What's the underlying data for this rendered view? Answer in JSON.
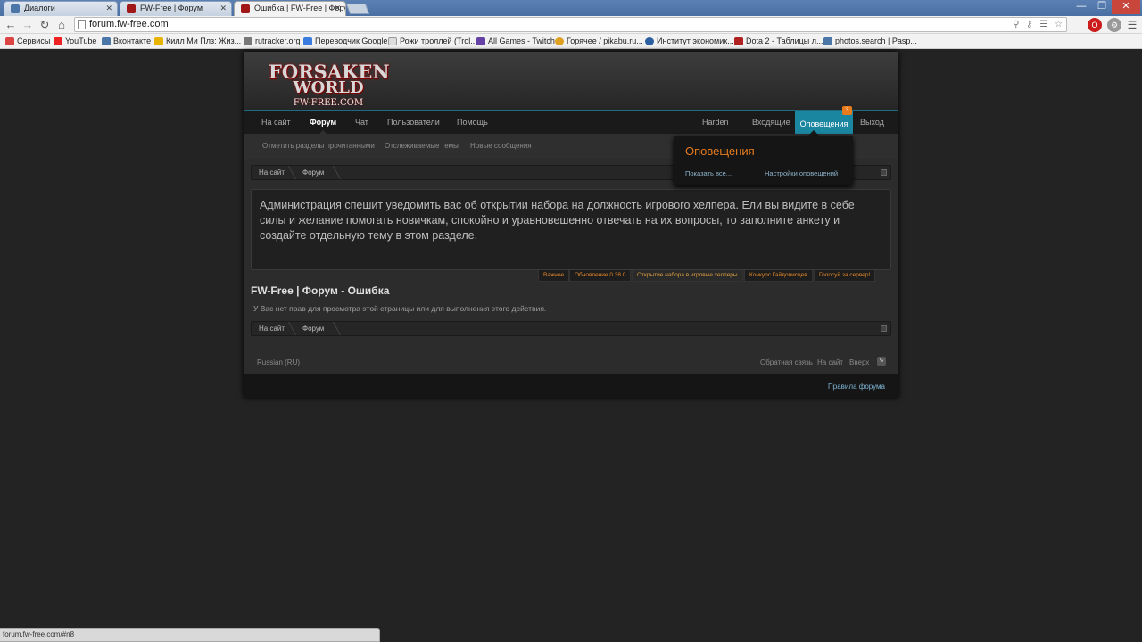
{
  "browser": {
    "tabs": [
      {
        "title": "Диалоги",
        "fav_color": "#4a76a8"
      },
      {
        "title": "FW-Free | Форум",
        "fav_color": "#a01818"
      },
      {
        "title": "Ошибка | FW-Free | Форум",
        "fav_color": "#a01818",
        "active": true
      }
    ],
    "close_glyph": "✕",
    "url": "forum.fw-free.com",
    "bookmarks": [
      {
        "label": "Сервисы",
        "fav_color": "#d44"
      },
      {
        "label": "YouTube",
        "fav_color": "#e22"
      },
      {
        "label": "Вконтакте",
        "fav_color": "#4a76a8"
      },
      {
        "label": "Килл Ми Плз: Жиз...",
        "fav_color": "#e8b400"
      },
      {
        "label": "rutracker.org",
        "fav_color": "#777"
      },
      {
        "label": "Переводчик Google",
        "fav_color": "#3a7be0"
      },
      {
        "label": "Рожи троллей (Trol...",
        "fav_color": "#ddd"
      },
      {
        "label": "All Games - Twitch",
        "fav_color": "#6441a5"
      },
      {
        "label": "Горячее / pikabu.ru...",
        "fav_color": "#e0a020"
      },
      {
        "label": "Институт экономик...",
        "fav_color": "#2a5fa0"
      },
      {
        "label": "Dota 2 - Таблицы л...",
        "fav_color": "#b02020"
      },
      {
        "label": "photos.search | Pasp...",
        "fav_color": "#4a76a8"
      }
    ],
    "status_url": "forum.fw-free.com/#n8"
  },
  "logo": {
    "line1": "FORSAKEN",
    "line2": "WORLD",
    "line3": "FW-FREE.COM"
  },
  "nav": {
    "left": [
      "На сайт",
      "Форум",
      "Чат",
      "Пользователи",
      "Помощь"
    ],
    "user": "Harden",
    "inbox": "Входящие",
    "alerts": "Оповещения",
    "alerts_count": "3",
    "logout": "Выход"
  },
  "subnav": [
    "Отметить разделы прочитанными",
    "Отслеживаемые темы",
    "Новые сообщения"
  ],
  "breadcrumbs": [
    "На сайт",
    "Форум"
  ],
  "notice": {
    "text": "Администрация спешит уведомить вас об открытии набора на должность игрового хелпера. Eли вы видите в себе силы и желание помогать новичкам, спокойно и уравновешенно отвечать на их вопросы, то заполните анкету и создайте отдельную тему в этом разделе.",
    "tabs": [
      "Важное",
      "Обновление 0.38.0",
      "Открытие набора в игровые хелперы",
      "Конкурс Гайдописцев",
      "Голосуй за сервер!"
    ]
  },
  "page": {
    "title": "FW-Free | Форум - Ошибка",
    "error": "У Вас нет прав для просмотра этой страницы или для выполнения этого действия."
  },
  "footer": {
    "language": "Russian (RU)",
    "links": [
      "Обратная связь",
      "На сайт",
      "Вверх"
    ],
    "rules": "Правила форума"
  },
  "popup": {
    "title": "Оповещения",
    "show_all": "Показать все...",
    "settings": "Настройки оповещений"
  },
  "colors": {
    "accent": "#1b86a0",
    "orange": "#e87b1c"
  }
}
